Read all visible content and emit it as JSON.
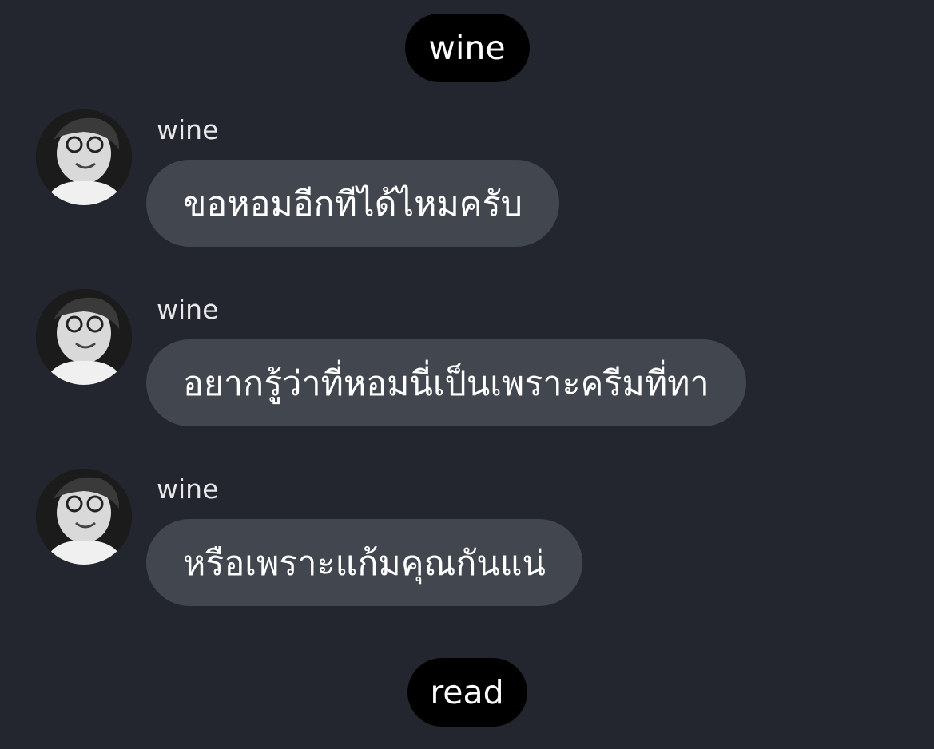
{
  "header": {
    "title": "wine"
  },
  "messages": [
    {
      "sender": "wine",
      "text": "ขอหอมอีกทีได้ไหมครับ"
    },
    {
      "sender": "wine",
      "text": "อยากรู้ว่าที่หอมนี่เป็นเพราะครีมที่ทา"
    },
    {
      "sender": "wine",
      "text": "หรือเพราะแก้มคุณกันแน่"
    }
  ],
  "footer": {
    "status": "read"
  },
  "colors": {
    "background": "#23262e",
    "bubble": "#42464e",
    "pill": "#000000",
    "text": "#ffffff"
  },
  "icons": {
    "avatar": "profile-photo-avatar"
  }
}
